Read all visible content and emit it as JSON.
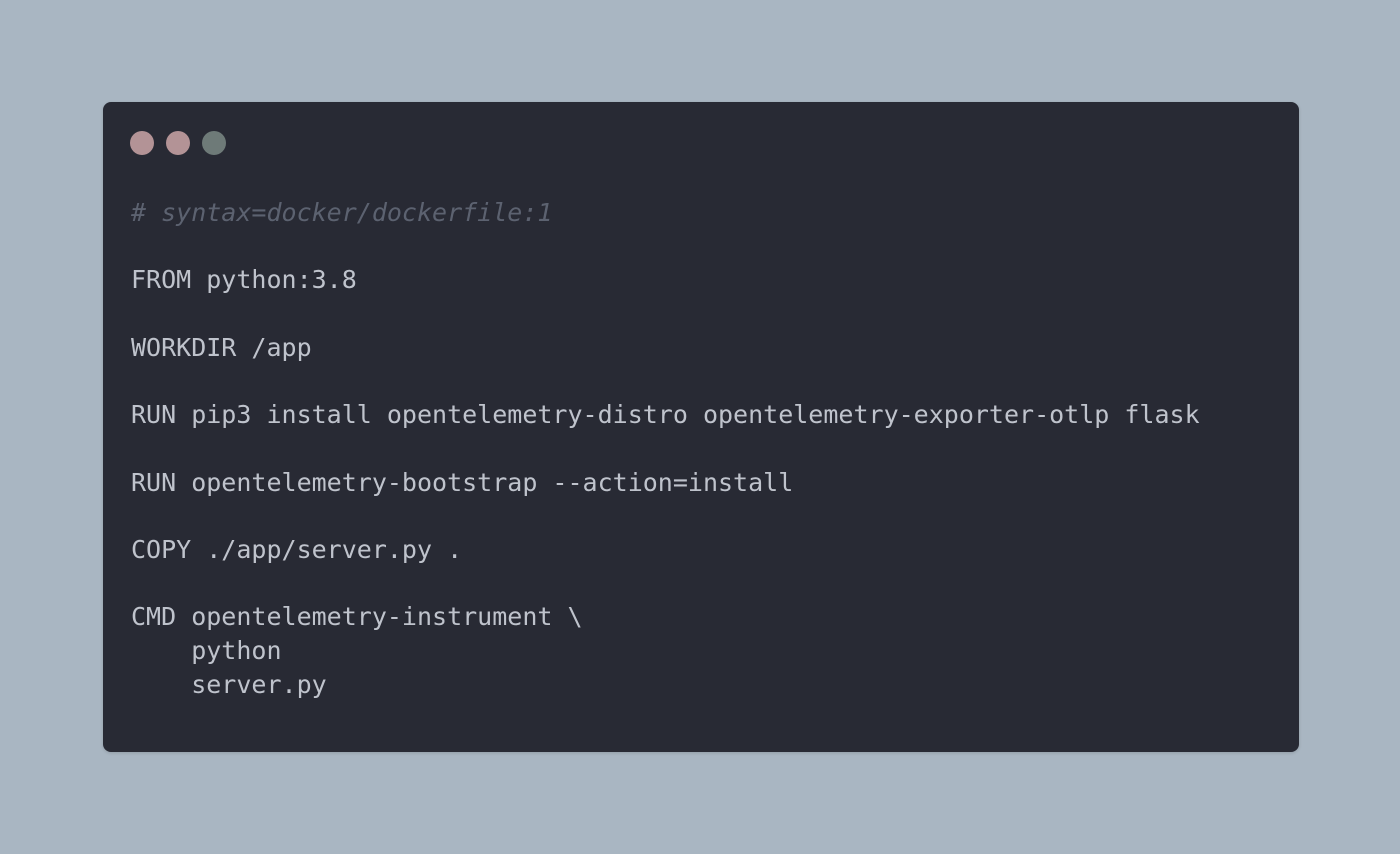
{
  "colors": {
    "background": "#a9b6c2",
    "window": "#282a34",
    "text": "#bfc3cc",
    "comment": "#5c6270",
    "dot_close": "#b39396",
    "dot_minimize": "#b39396",
    "dot_maximize": "#6e7a78"
  },
  "window_controls": [
    "close",
    "minimize",
    "maximize"
  ],
  "code": {
    "language": "dockerfile",
    "lines": [
      {
        "text": "# syntax=docker/dockerfile:1",
        "kind": "comment"
      },
      {
        "text": "",
        "kind": "blank"
      },
      {
        "text": "FROM python:3.8",
        "kind": "code"
      },
      {
        "text": "",
        "kind": "blank"
      },
      {
        "text": "WORKDIR /app",
        "kind": "code"
      },
      {
        "text": "",
        "kind": "blank"
      },
      {
        "text": "RUN pip3 install opentelemetry-distro opentelemetry-exporter-otlp flask",
        "kind": "code"
      },
      {
        "text": "",
        "kind": "blank"
      },
      {
        "text": "RUN opentelemetry-bootstrap --action=install",
        "kind": "code"
      },
      {
        "text": "",
        "kind": "blank"
      },
      {
        "text": "COPY ./app/server.py .",
        "kind": "code"
      },
      {
        "text": "",
        "kind": "blank"
      },
      {
        "text": "CMD opentelemetry-instrument \\",
        "kind": "code"
      },
      {
        "text": "    python",
        "kind": "code"
      },
      {
        "text": "    server.py",
        "kind": "code"
      }
    ]
  }
}
